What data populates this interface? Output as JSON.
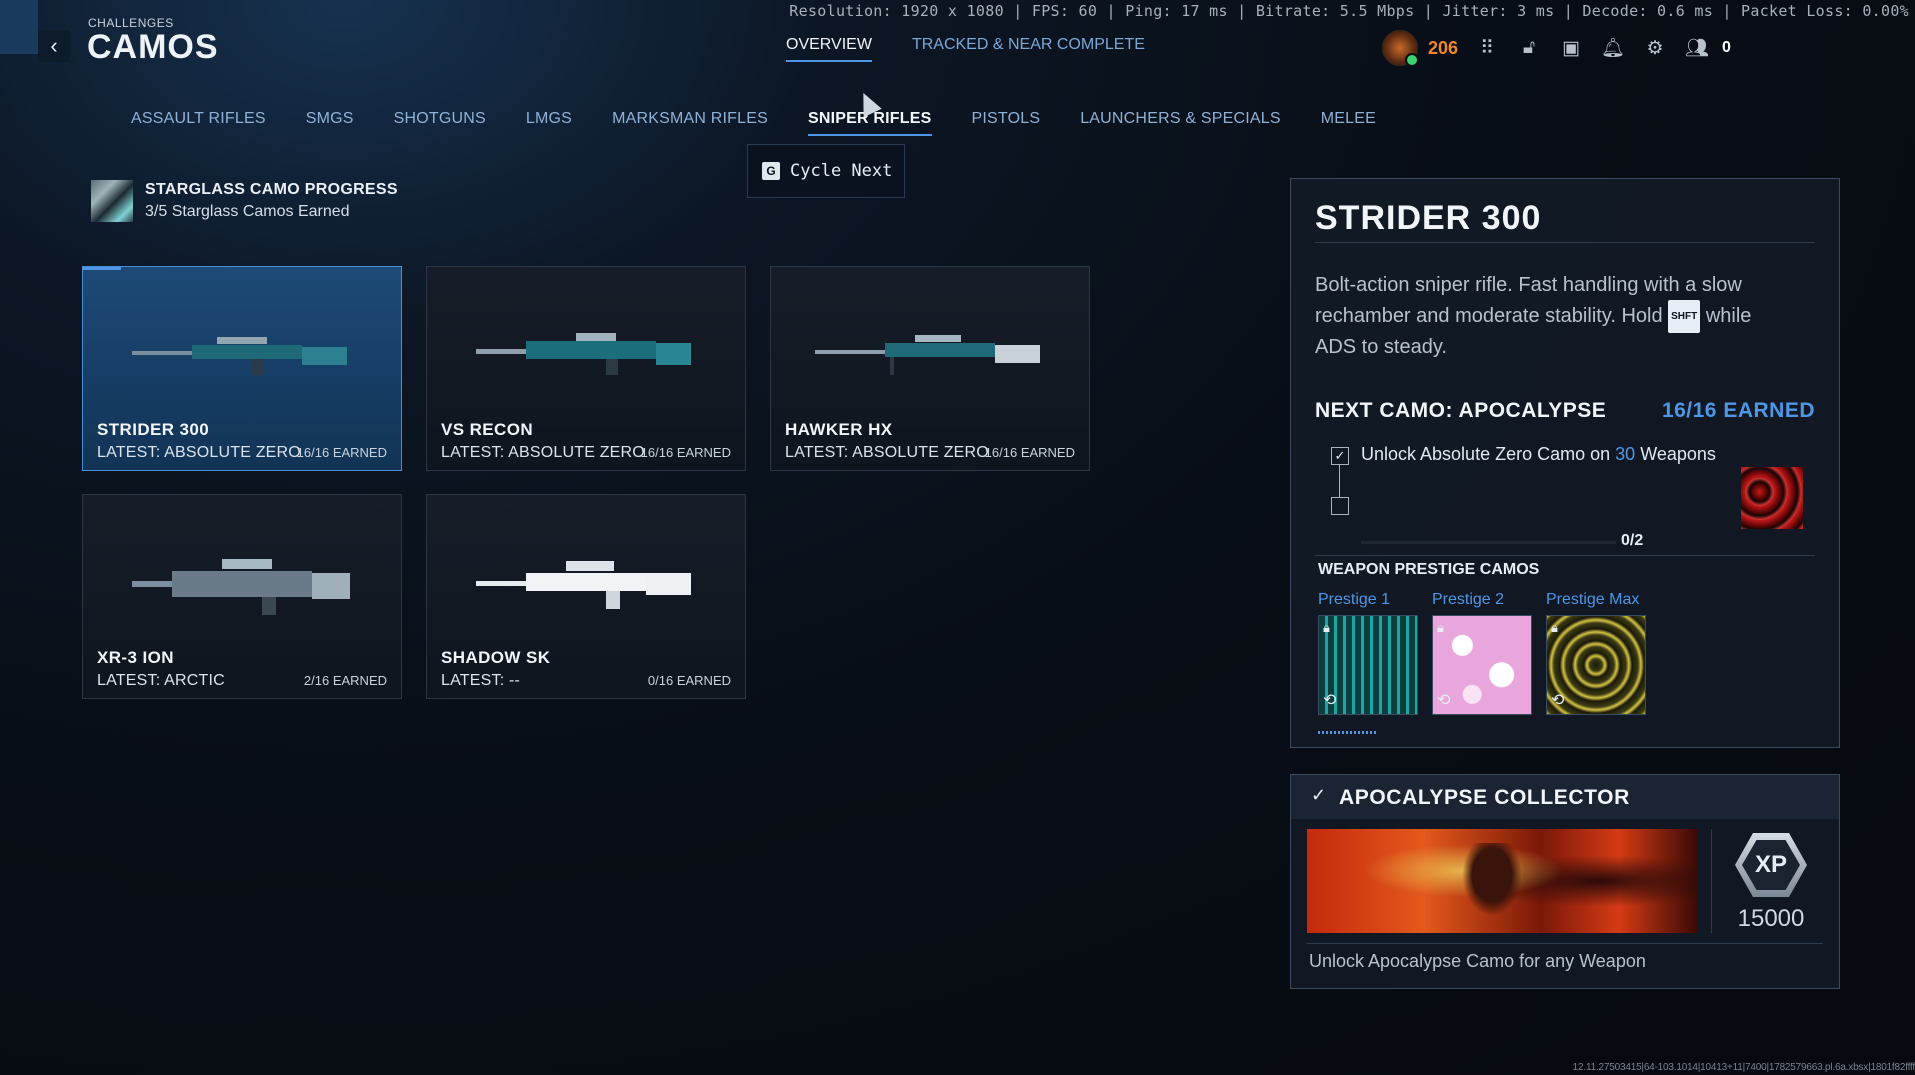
{
  "stats_bar": "Resolution: 1920 x 1080 | FPS: 60 | Ping: 17 ms | Bitrate: 5.5 Mbps | Jitter: 3 ms | Decode: 0.6 ms | Packet Loss: 0.00%",
  "header": {
    "breadcrumb": "CHALLENGES",
    "title": "CAMOS",
    "back_icon": "chevron-left-icon",
    "tabs": [
      {
        "label": "OVERVIEW",
        "active": true
      },
      {
        "label": "TRACKED & NEAR COMPLETE",
        "active": false
      }
    ]
  },
  "hud": {
    "currency": "206",
    "icons": [
      "grid-icon",
      "unlock-icon",
      "camera-icon",
      "bell-icon",
      "gear-icon",
      "party-icon"
    ],
    "party_count": "0",
    "accent_currency_color": "#f0862a",
    "status_dot_color": "#3bd16f"
  },
  "categories": [
    {
      "label": "ASSAULT RIFLES",
      "active": false
    },
    {
      "label": "SMGS",
      "active": false
    },
    {
      "label": "SHOTGUNS",
      "active": false
    },
    {
      "label": "LMGS",
      "active": false
    },
    {
      "label": "MARKSMAN RIFLES",
      "active": false
    },
    {
      "label": "SNIPER RIFLES",
      "active": true
    },
    {
      "label": "PISTOLS",
      "active": false
    },
    {
      "label": "LAUNCHERS & SPECIALS",
      "active": false
    },
    {
      "label": "MELEE",
      "active": false
    }
  ],
  "tooltip": {
    "key": "G",
    "label": "Cycle Next"
  },
  "progress": {
    "title": "STARGLASS CAMO PROGRESS",
    "subtitle": "3/5 Starglass Camos Earned"
  },
  "weapons": [
    {
      "name": "STRIDER 300",
      "latest": "LATEST: ABSOLUTE ZERO",
      "earned": "16/16 EARNED",
      "selected": true
    },
    {
      "name": "VS RECON",
      "latest": "LATEST: ABSOLUTE ZERO",
      "earned": "16/16 EARNED",
      "selected": false
    },
    {
      "name": "HAWKER HX",
      "latest": "LATEST: ABSOLUTE ZERO",
      "earned": "16/16 EARNED",
      "selected": false
    },
    {
      "name": "XR-3 ION",
      "latest": "LATEST: ARCTIC",
      "earned": "2/16 EARNED",
      "selected": false
    },
    {
      "name": "SHADOW SK",
      "latest": "LATEST: --",
      "earned": "0/16 EARNED",
      "selected": false
    }
  ],
  "detail": {
    "title": "STRIDER 300",
    "desc_part1": "Bolt-action sniper rifle. Fast handling with a slow rechamber and moderate stability. Hold",
    "shift_key": "SHFT",
    "desc_part2": "while ADS to steady.",
    "next_camo": "NEXT CAMO: APOCALYPSE",
    "earned": "16/16 EARNED",
    "requirement_prefix": "Unlock Absolute Zero Camo on",
    "requirement_count": "30",
    "requirement_suffix": "Weapons",
    "progress_label": "0/2",
    "progress_fraction": 0,
    "prestige_header": "WEAPON PRESTIGE CAMOS",
    "prestige": [
      {
        "label": "Prestige 1"
      },
      {
        "label": "Prestige 2"
      },
      {
        "label": "Prestige Max"
      }
    ]
  },
  "collector": {
    "title": "APOCALYPSE COLLECTOR",
    "xp_label": "XP",
    "xp_value": "15000",
    "description": "Unlock Apocalypse Camo for any Weapon"
  },
  "footer_code": "12.11.27503415|64-103.1014|10413+11|7400|1782579663.pl.6a.xbsx|1801f82ffff"
}
